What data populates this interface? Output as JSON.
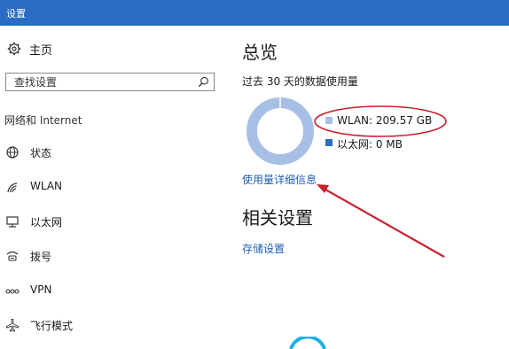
{
  "window": {
    "title": "设置"
  },
  "sidebar": {
    "home": {
      "label": "主页",
      "icon": "gear-icon"
    },
    "search": {
      "placeholder": "查找设置",
      "icon": "search-icon"
    },
    "section": "网络和 Internet",
    "items": [
      {
        "label": "状态",
        "icon": "globe-icon"
      },
      {
        "label": "WLAN",
        "icon": "wifi-icon"
      },
      {
        "label": "以太网",
        "icon": "ethernet-icon"
      },
      {
        "label": "拨号",
        "icon": "dialup-icon"
      },
      {
        "label": "VPN",
        "icon": "vpn-icon"
      },
      {
        "label": "飞行模式",
        "icon": "airplane-icon"
      }
    ]
  },
  "main": {
    "title": "总览",
    "subtitle": "过去 30 天的数据使用量",
    "usage": [
      {
        "name": "WLAN",
        "value_text": "WLAN: 209.57 GB",
        "gb": 209.57,
        "color": "#a7bfe4"
      },
      {
        "name": "以太网",
        "value_text": "以太网: 0 MB",
        "gb": 0,
        "color": "#2b6cc4"
      }
    ],
    "details_link": "使用量详细信息",
    "related_title": "相关设置",
    "storage_link": "存储设置"
  },
  "colors": {
    "titlebar": "#2b6cc4",
    "accent": "#2b6cc4",
    "donut_fill": "#a7bfe4",
    "link": "#1f5fb4",
    "annotation": "#c8202f"
  }
}
